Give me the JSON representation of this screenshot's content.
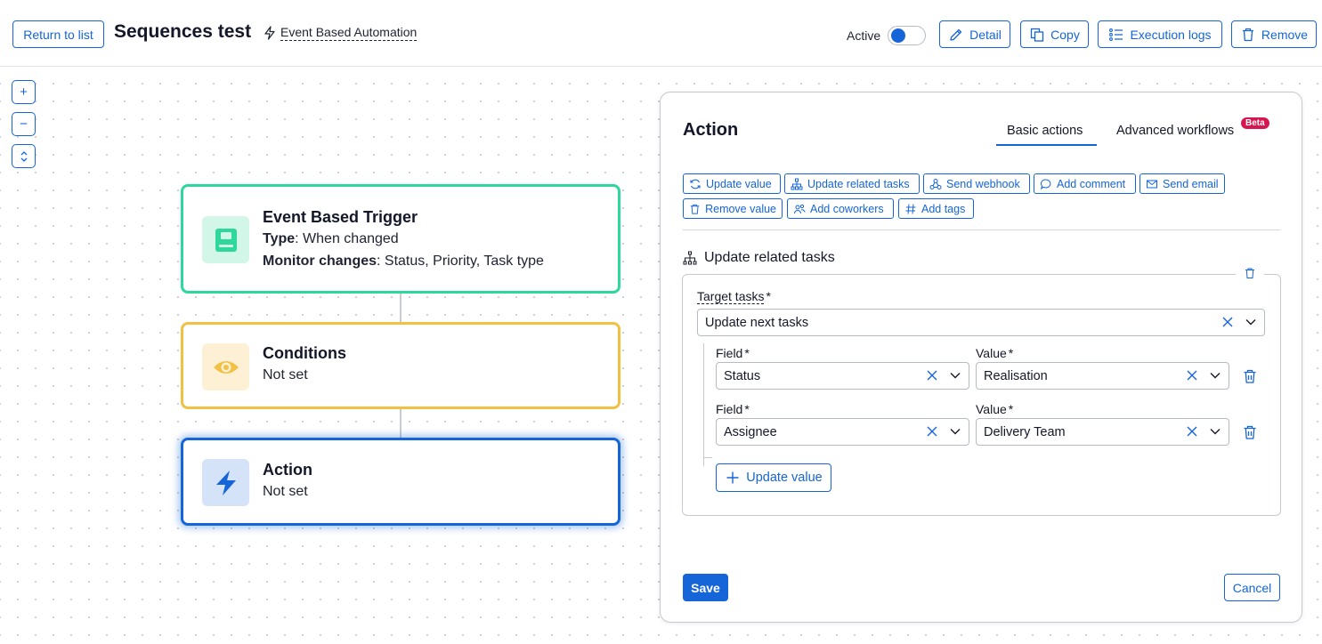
{
  "header": {
    "return_label": "Return to list",
    "title": "Sequences test",
    "automation_type": "Event Based Automation",
    "active_label": "Active",
    "active_on": true,
    "detail_label": "Detail",
    "copy_label": "Copy",
    "logs_label": "Execution logs",
    "remove_label": "Remove"
  },
  "zoom": {
    "in": "+",
    "out": "−"
  },
  "nodes": {
    "trigger": {
      "title": "Event Based Trigger",
      "type_key": "Type",
      "type_value": ": When changed",
      "monitor_key": "Monitor changes",
      "monitor_value": ": Status, Priority, Task type",
      "color": "#2ed89c"
    },
    "conditions": {
      "title": "Conditions",
      "status": "Not set",
      "color": "#f2c043"
    },
    "action": {
      "title": "Action",
      "status": "Not set",
      "color": "#1565d8"
    }
  },
  "panel": {
    "title": "Action",
    "tabs": [
      {
        "label": "Basic actions",
        "active": true
      },
      {
        "label": "Advanced workflows",
        "badge": "Beta",
        "active": false
      }
    ],
    "chips": [
      {
        "label": "Update value",
        "icon": "refresh-icon"
      },
      {
        "label": "Update related tasks",
        "icon": "hierarchy-icon"
      },
      {
        "label": "Send webhook",
        "icon": "webhook-icon"
      },
      {
        "label": "Add comment",
        "icon": "comment-icon"
      },
      {
        "label": "Send email",
        "icon": "email-icon"
      },
      {
        "label": "Remove value",
        "icon": "trash-icon"
      },
      {
        "label": "Add coworkers",
        "icon": "users-icon"
      },
      {
        "label": "Add tags",
        "icon": "hash-icon"
      }
    ],
    "section": {
      "title": "Update related tasks",
      "target_label": "Target tasks",
      "required_mark": "*",
      "target_value": "Update next tasks",
      "field_label": "Field",
      "value_label": "Value",
      "rows": [
        {
          "field": "Status",
          "value": "Realisation"
        },
        {
          "field": "Assignee",
          "value": "Delivery Team"
        }
      ],
      "add_value_label": "Update value"
    },
    "save_label": "Save",
    "cancel_label": "Cancel"
  },
  "colors": {
    "accent": "#1565d8",
    "beta": "#d6164f"
  }
}
